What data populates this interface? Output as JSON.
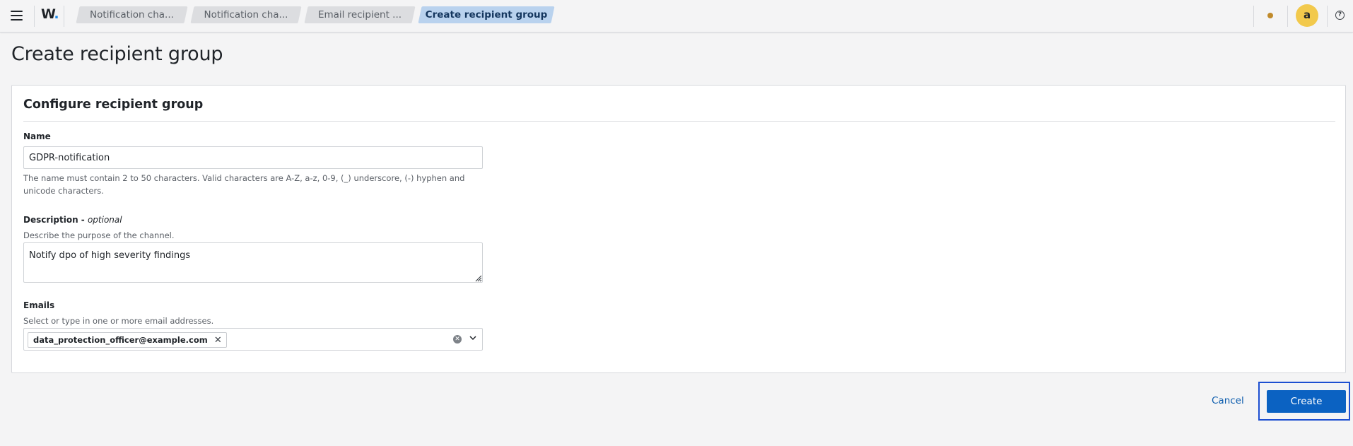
{
  "app": {
    "logo_text": "W",
    "logo_dot": "."
  },
  "breadcrumbs": [
    {
      "label": "Notification cha..."
    },
    {
      "label": "Notification cha..."
    },
    {
      "label": "Email recipient ..."
    },
    {
      "label": "Create recipient group"
    }
  ],
  "user": {
    "avatar_initial": "a"
  },
  "help_glyph": "?",
  "page": {
    "title": "Create recipient group"
  },
  "panel": {
    "title": "Configure recipient group",
    "name": {
      "label": "Name",
      "value": "GDPR-notification",
      "hint": "The name must contain 2 to 50 characters. Valid characters are A-Z, a-z, 0-9, (_) underscore, (-) hyphen and unicode characters."
    },
    "description": {
      "label": "Description - ",
      "optional": "optional",
      "hint": "Describe the purpose of the channel.",
      "value": "Notify dpo of high severity findings"
    },
    "emails": {
      "label": "Emails",
      "hint": "Select or type in one or more email addresses.",
      "selected": [
        "data_protection_officer@example.com"
      ]
    }
  },
  "actions": {
    "cancel": "Cancel",
    "create": "Create"
  },
  "colors": {
    "accent": "#0b62c2",
    "breadcrumb_active": "#b9d2ee",
    "avatar": "#f2c94c",
    "focus_outline": "#1d4fd1"
  }
}
